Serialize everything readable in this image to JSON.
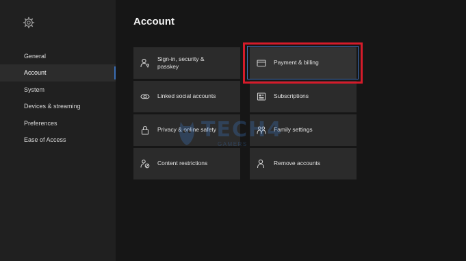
{
  "page": {
    "title": "Account"
  },
  "sidebar": {
    "items": [
      {
        "label": "General"
      },
      {
        "label": "Account"
      },
      {
        "label": "System"
      },
      {
        "label": "Devices & streaming"
      },
      {
        "label": "Preferences"
      },
      {
        "label": "Ease of Access"
      }
    ],
    "selected": "Account"
  },
  "tiles": [
    {
      "label": "Sign-in, security & passkey",
      "icon": "person-key-icon"
    },
    {
      "label": "Payment & billing",
      "icon": "credit-card-icon",
      "highlighted": true
    },
    {
      "label": "Linked social accounts",
      "icon": "linked-chain-icon"
    },
    {
      "label": "Subscriptions",
      "icon": "subscriptions-icon"
    },
    {
      "label": "Privacy & online safety",
      "icon": "lock-icon"
    },
    {
      "label": "Family settings",
      "icon": "family-icon"
    },
    {
      "label": "Content restrictions",
      "icon": "content-restrictions-icon"
    },
    {
      "label": "Remove accounts",
      "icon": "person-remove-icon"
    }
  ],
  "watermark": {
    "brand": "TECH4",
    "tagline": "GAMERS"
  },
  "colors": {
    "highlight_border": "#d51b2a",
    "focus_border": "#3d6fb8",
    "accent": "#3b6fb6"
  }
}
